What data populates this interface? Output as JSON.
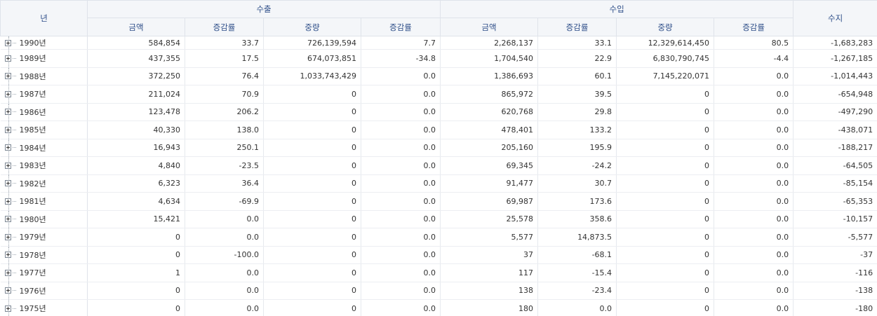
{
  "headers": {
    "year": "년",
    "exports": "수출",
    "imports": "수입",
    "balance": "수지",
    "amount": "금액",
    "change_rate": "증감률",
    "weight": "중량"
  },
  "rows": [
    {
      "year": "1990년",
      "ea": "584,854",
      "er": "33.7",
      "ew": "726,139,594",
      "ewr": "7.7",
      "ia": "2,268,137",
      "ir": "33.1",
      "iw": "12,329,614,450",
      "iwr": "80.5",
      "bal": "-1,683,283"
    },
    {
      "year": "1989년",
      "ea": "437,355",
      "er": "17.5",
      "ew": "674,073,851",
      "ewr": "-34.8",
      "ia": "1,704,540",
      "ir": "22.9",
      "iw": "6,830,790,745",
      "iwr": "-4.4",
      "bal": "-1,267,185"
    },
    {
      "year": "1988년",
      "ea": "372,250",
      "er": "76.4",
      "ew": "1,033,743,429",
      "ewr": "0.0",
      "ia": "1,386,693",
      "ir": "60.1",
      "iw": "7,145,220,071",
      "iwr": "0.0",
      "bal": "-1,014,443"
    },
    {
      "year": "1987년",
      "ea": "211,024",
      "er": "70.9",
      "ew": "0",
      "ewr": "0.0",
      "ia": "865,972",
      "ir": "39.5",
      "iw": "0",
      "iwr": "0.0",
      "bal": "-654,948"
    },
    {
      "year": "1986년",
      "ea": "123,478",
      "er": "206.2",
      "ew": "0",
      "ewr": "0.0",
      "ia": "620,768",
      "ir": "29.8",
      "iw": "0",
      "iwr": "0.0",
      "bal": "-497,290"
    },
    {
      "year": "1985년",
      "ea": "40,330",
      "er": "138.0",
      "ew": "0",
      "ewr": "0.0",
      "ia": "478,401",
      "ir": "133.2",
      "iw": "0",
      "iwr": "0.0",
      "bal": "-438,071"
    },
    {
      "year": "1984년",
      "ea": "16,943",
      "er": "250.1",
      "ew": "0",
      "ewr": "0.0",
      "ia": "205,160",
      "ir": "195.9",
      "iw": "0",
      "iwr": "0.0",
      "bal": "-188,217"
    },
    {
      "year": "1983년",
      "ea": "4,840",
      "er": "-23.5",
      "ew": "0",
      "ewr": "0.0",
      "ia": "69,345",
      "ir": "-24.2",
      "iw": "0",
      "iwr": "0.0",
      "bal": "-64,505"
    },
    {
      "year": "1982년",
      "ea": "6,323",
      "er": "36.4",
      "ew": "0",
      "ewr": "0.0",
      "ia": "91,477",
      "ir": "30.7",
      "iw": "0",
      "iwr": "0.0",
      "bal": "-85,154"
    },
    {
      "year": "1981년",
      "ea": "4,634",
      "er": "-69.9",
      "ew": "0",
      "ewr": "0.0",
      "ia": "69,987",
      "ir": "173.6",
      "iw": "0",
      "iwr": "0.0",
      "bal": "-65,353"
    },
    {
      "year": "1980년",
      "ea": "15,421",
      "er": "0.0",
      "ew": "0",
      "ewr": "0.0",
      "ia": "25,578",
      "ir": "358.6",
      "iw": "0",
      "iwr": "0.0",
      "bal": "-10,157"
    },
    {
      "year": "1979년",
      "ea": "0",
      "er": "0.0",
      "ew": "0",
      "ewr": "0.0",
      "ia": "5,577",
      "ir": "14,873.5",
      "iw": "0",
      "iwr": "0.0",
      "bal": "-5,577"
    },
    {
      "year": "1978년",
      "ea": "0",
      "er": "-100.0",
      "ew": "0",
      "ewr": "0.0",
      "ia": "37",
      "ir": "-68.1",
      "iw": "0",
      "iwr": "0.0",
      "bal": "-37"
    },
    {
      "year": "1977년",
      "ea": "1",
      "er": "0.0",
      "ew": "0",
      "ewr": "0.0",
      "ia": "117",
      "ir": "-15.4",
      "iw": "0",
      "iwr": "0.0",
      "bal": "-116"
    },
    {
      "year": "1976년",
      "ea": "0",
      "er": "0.0",
      "ew": "0",
      "ewr": "0.0",
      "ia": "138",
      "ir": "-23.4",
      "iw": "0",
      "iwr": "0.0",
      "bal": "-138"
    },
    {
      "year": "1975년",
      "ea": "0",
      "er": "0.0",
      "ew": "0",
      "ewr": "0.0",
      "ia": "180",
      "ir": "0.0",
      "iw": "0",
      "iwr": "0.0",
      "bal": "-180"
    }
  ],
  "colors": {
    "header_bg": "#f4f6f9",
    "header_text": "#30508a",
    "grid_line": "#e6e9ee"
  },
  "icons": {
    "row_toggle": "plus-box-icon"
  }
}
